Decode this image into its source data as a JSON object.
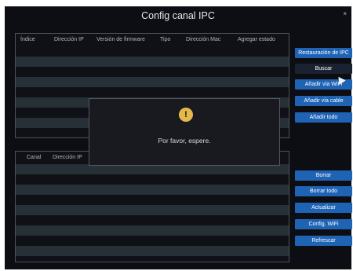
{
  "dialog": {
    "title": "Config canal IPC",
    "close": "×"
  },
  "table_top": {
    "headers": [
      "Índice",
      "Dirección IP",
      "Versión de firmware",
      "Tipo",
      "Dirección Mac",
      "Agregar estado"
    ]
  },
  "table_bottom": {
    "headers": [
      "Canal",
      "Dirección IP"
    ]
  },
  "buttons_top": {
    "restore": "Restauración de IPC",
    "search": "Buscar",
    "add_wifi": "Añadir vía WiFi",
    "add_cable": "Añadir vía cable",
    "add_all": "Añadir todo"
  },
  "buttons_bottom": {
    "delete": "Borrar",
    "delete_all": "Borrar todo",
    "update": "Actualizar",
    "wifi_config": "Config. WiFi",
    "refresh": "Refrescar"
  },
  "popup": {
    "icon": "!",
    "message": "Por favor, espere."
  },
  "colors": {
    "accent": "#1f63b5",
    "warning": "#e6b84a",
    "background": "#0d0e13"
  }
}
